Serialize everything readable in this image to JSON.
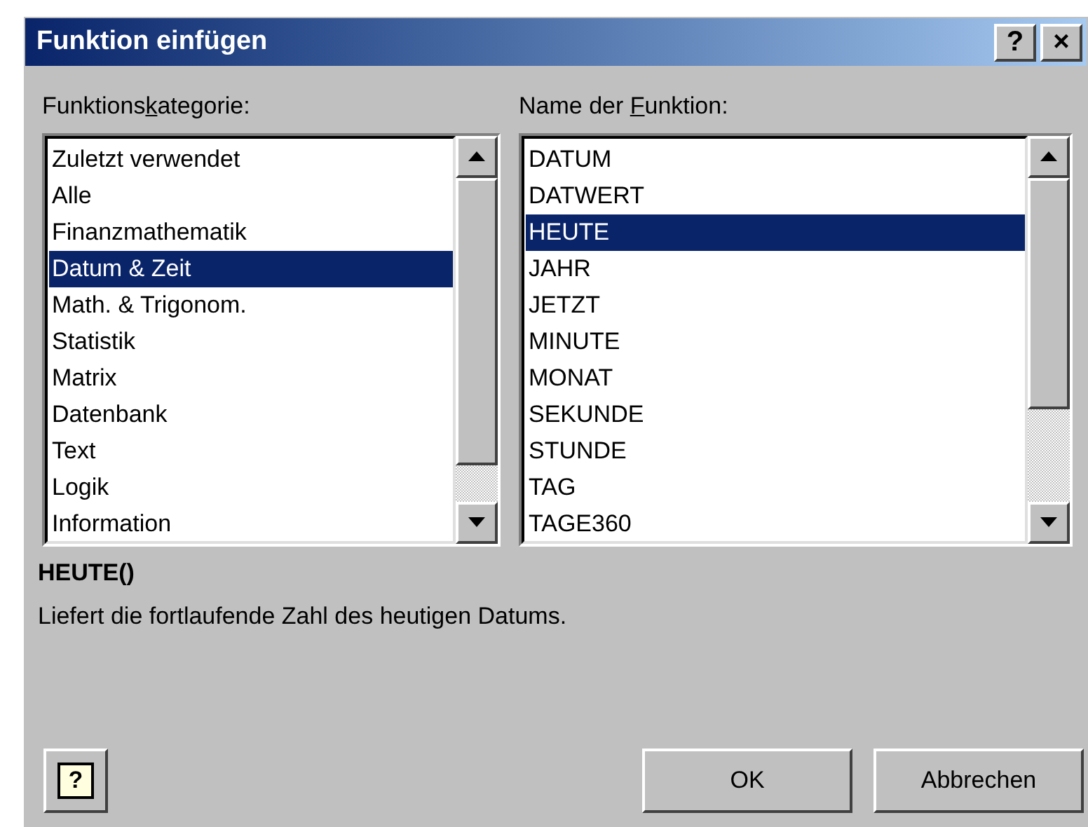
{
  "window": {
    "title": "Funktion einfügen",
    "title_buttons": [
      "?",
      "×"
    ]
  },
  "categories": {
    "label_parts": [
      "Funktions",
      "k",
      "ategorie:"
    ],
    "items": [
      {
        "label": "Zuletzt verwendet",
        "selected": false
      },
      {
        "label": "Alle",
        "selected": false
      },
      {
        "label": "Finanzmathematik",
        "selected": false
      },
      {
        "label": "Datum & Zeit",
        "selected": true
      },
      {
        "label": "Math. & Trigonom.",
        "selected": false
      },
      {
        "label": "Statistik",
        "selected": false
      },
      {
        "label": "Matrix",
        "selected": false
      },
      {
        "label": "Datenbank",
        "selected": false
      },
      {
        "label": "Text",
        "selected": false
      },
      {
        "label": "Logik",
        "selected": false
      },
      {
        "label": "Information",
        "selected": false
      }
    ]
  },
  "functions": {
    "label_parts": [
      "Name der ",
      "F",
      "unktion:"
    ],
    "items": [
      {
        "label": "DATUM",
        "selected": false
      },
      {
        "label": "DATWERT",
        "selected": false
      },
      {
        "label": "HEUTE",
        "selected": true
      },
      {
        "label": "JAHR",
        "selected": false
      },
      {
        "label": "JETZT",
        "selected": false
      },
      {
        "label": "MINUTE",
        "selected": false
      },
      {
        "label": "MONAT",
        "selected": false
      },
      {
        "label": "SEKUNDE",
        "selected": false
      },
      {
        "label": "STUNDE",
        "selected": false
      },
      {
        "label": "TAG",
        "selected": false
      },
      {
        "label": "TAGE360",
        "selected": false
      }
    ]
  },
  "signature": "HEUTE()",
  "description": "Liefert die fortlaufende Zahl des heutigen Datums.",
  "help_button": "?",
  "buttons": [
    "OK",
    "Abbrechen"
  ]
}
